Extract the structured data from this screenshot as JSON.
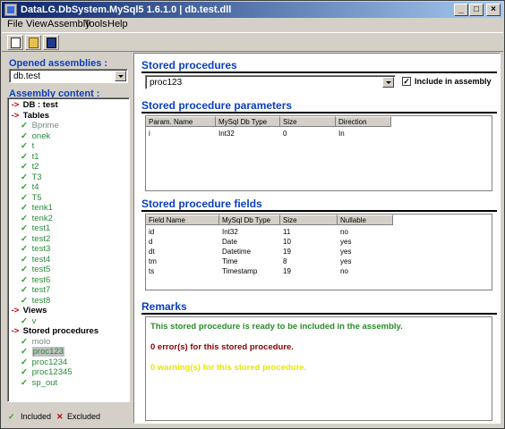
{
  "window": {
    "title": "DataLG.DbSystem.MySql5 1.6.1.0 | db.test.dll",
    "minimize": "_",
    "maximize": "□",
    "close": "×"
  },
  "menu": [
    "File",
    "View",
    "Assembly",
    "Tools",
    "Help"
  ],
  "toolbar": {
    "new_icon": "new-document-icon",
    "open_icon": "open-folder-icon",
    "save_icon": "save-disk-icon"
  },
  "left": {
    "opened_label": "Opened assemblies :",
    "opened_value": "db.test",
    "content_label": "Assembly content :",
    "tree": [
      {
        "kind": "arrow",
        "style": "head",
        "text": "DB : test"
      },
      {
        "kind": "arrow",
        "style": "head",
        "text": "Tables"
      },
      {
        "kind": "check",
        "style": "gray",
        "text": "Bprime"
      },
      {
        "kind": "check",
        "style": "item",
        "text": "onek"
      },
      {
        "kind": "check",
        "style": "item",
        "text": "t"
      },
      {
        "kind": "check",
        "style": "item",
        "text": "t1"
      },
      {
        "kind": "check",
        "style": "item",
        "text": "t2"
      },
      {
        "kind": "check",
        "style": "item",
        "text": "T3"
      },
      {
        "kind": "check",
        "style": "item",
        "text": "t4"
      },
      {
        "kind": "check",
        "style": "item",
        "text": "T5"
      },
      {
        "kind": "check",
        "style": "item",
        "text": "tenk1"
      },
      {
        "kind": "check",
        "style": "item",
        "text": "tenk2"
      },
      {
        "kind": "check",
        "style": "item",
        "text": "test1"
      },
      {
        "kind": "check",
        "style": "item",
        "text": "test2"
      },
      {
        "kind": "check",
        "style": "item",
        "text": "test3"
      },
      {
        "kind": "check",
        "style": "item",
        "text": "test4"
      },
      {
        "kind": "check",
        "style": "item",
        "text": "test5"
      },
      {
        "kind": "check",
        "style": "item",
        "text": "test6"
      },
      {
        "kind": "check",
        "style": "item",
        "text": "test7"
      },
      {
        "kind": "check",
        "style": "item",
        "text": "test8"
      },
      {
        "kind": "arrow",
        "style": "head",
        "text": "Views"
      },
      {
        "kind": "check",
        "style": "item",
        "text": "v"
      },
      {
        "kind": "arrow",
        "style": "head",
        "text": "Stored procedures"
      },
      {
        "kind": "check",
        "style": "gray",
        "text": "molo"
      },
      {
        "kind": "check",
        "style": "item",
        "text": "proc123",
        "selected": true
      },
      {
        "kind": "check",
        "style": "item",
        "text": "proc1234"
      },
      {
        "kind": "check",
        "style": "item",
        "text": "proc12345"
      },
      {
        "kind": "check",
        "style": "item",
        "text": "sp_out"
      }
    ],
    "legend_included": "Included",
    "legend_excluded": "Excluded"
  },
  "stored_procedures": {
    "title": "Stored procedures",
    "selected": "proc123",
    "include_label": "Include in assembly",
    "include_checked": true
  },
  "parameters": {
    "title": "Stored procedure parameters",
    "columns": [
      "Param. Name",
      "MySql Db Type",
      "Size",
      "Direction"
    ],
    "rows": [
      [
        "i",
        "Int32",
        "0",
        "In"
      ]
    ]
  },
  "fields": {
    "title": "Stored procedure fields",
    "columns": [
      "Field Name",
      "MySql Db Type",
      "Size",
      "Nullable"
    ],
    "rows": [
      [
        "id",
        "Int32",
        "11",
        "no"
      ],
      [
        "d",
        "Date",
        "10",
        "yes"
      ],
      [
        "dt",
        "Datetime",
        "19",
        "yes"
      ],
      [
        "tm",
        "Time",
        "8",
        "yes"
      ],
      [
        "ts",
        "Timestamp",
        "19",
        "no"
      ]
    ]
  },
  "remarks": {
    "title": "Remarks",
    "line1": "This stored procedure is ready to be included in the assembly.",
    "line2": "0 error(s) for this stored procedure.",
    "line3": "0 warning(s) for this stored procedure.",
    "colors": {
      "ok": "#2a8a2a",
      "error": "#8b0000",
      "warning": "#e6e600"
    }
  }
}
